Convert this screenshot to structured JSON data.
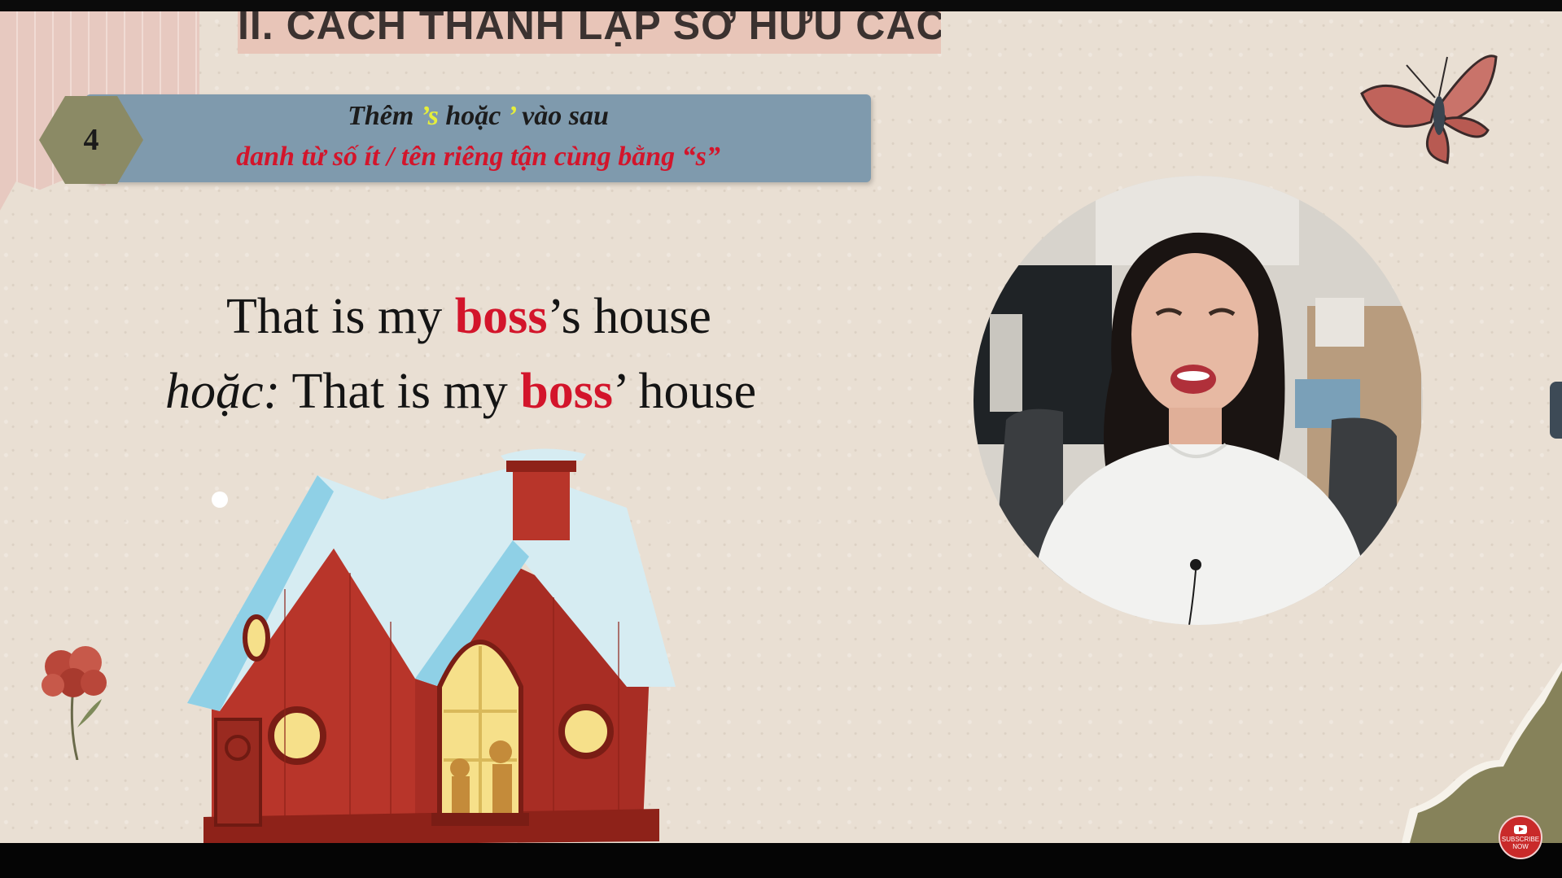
{
  "slide": {
    "title": "II. CÁCH THÀNH LẬP SỞ HỮU CÁCH",
    "step_number": "4",
    "rule": {
      "line1_part1": "Thêm ",
      "line1_apos_s": "’s",
      "line1_part2": " hoặc ",
      "line1_apos": "’",
      "line1_part3": " vào sau",
      "line2": "danh từ số ít / tên riêng tận cùng bằng “s”"
    },
    "example1": {
      "prefix": "That is my ",
      "highlight": "boss",
      "suffix": "’s house"
    },
    "example2": {
      "label": "hoặc:",
      "prefix": " That is my ",
      "highlight": "boss",
      "suffix": "’ house"
    }
  },
  "overlay": {
    "subscribe_line1": "SUBSCRIBE",
    "subscribe_line2": "NOW"
  },
  "icons": {
    "house": "house-illustration",
    "flower": "flower-icon",
    "butterfly": "butterfly-icon",
    "subscribe": "youtube-icon",
    "side_tab": "chevron-left-icon"
  },
  "colors": {
    "slide_bg": "#e9dfd3",
    "banner": "#7f9aad",
    "hexagon": "#8b8a65",
    "highlight_red": "#d3152b",
    "highlight_yellow": "#e6ef3a",
    "title_bg": "#e8c5b8"
  }
}
